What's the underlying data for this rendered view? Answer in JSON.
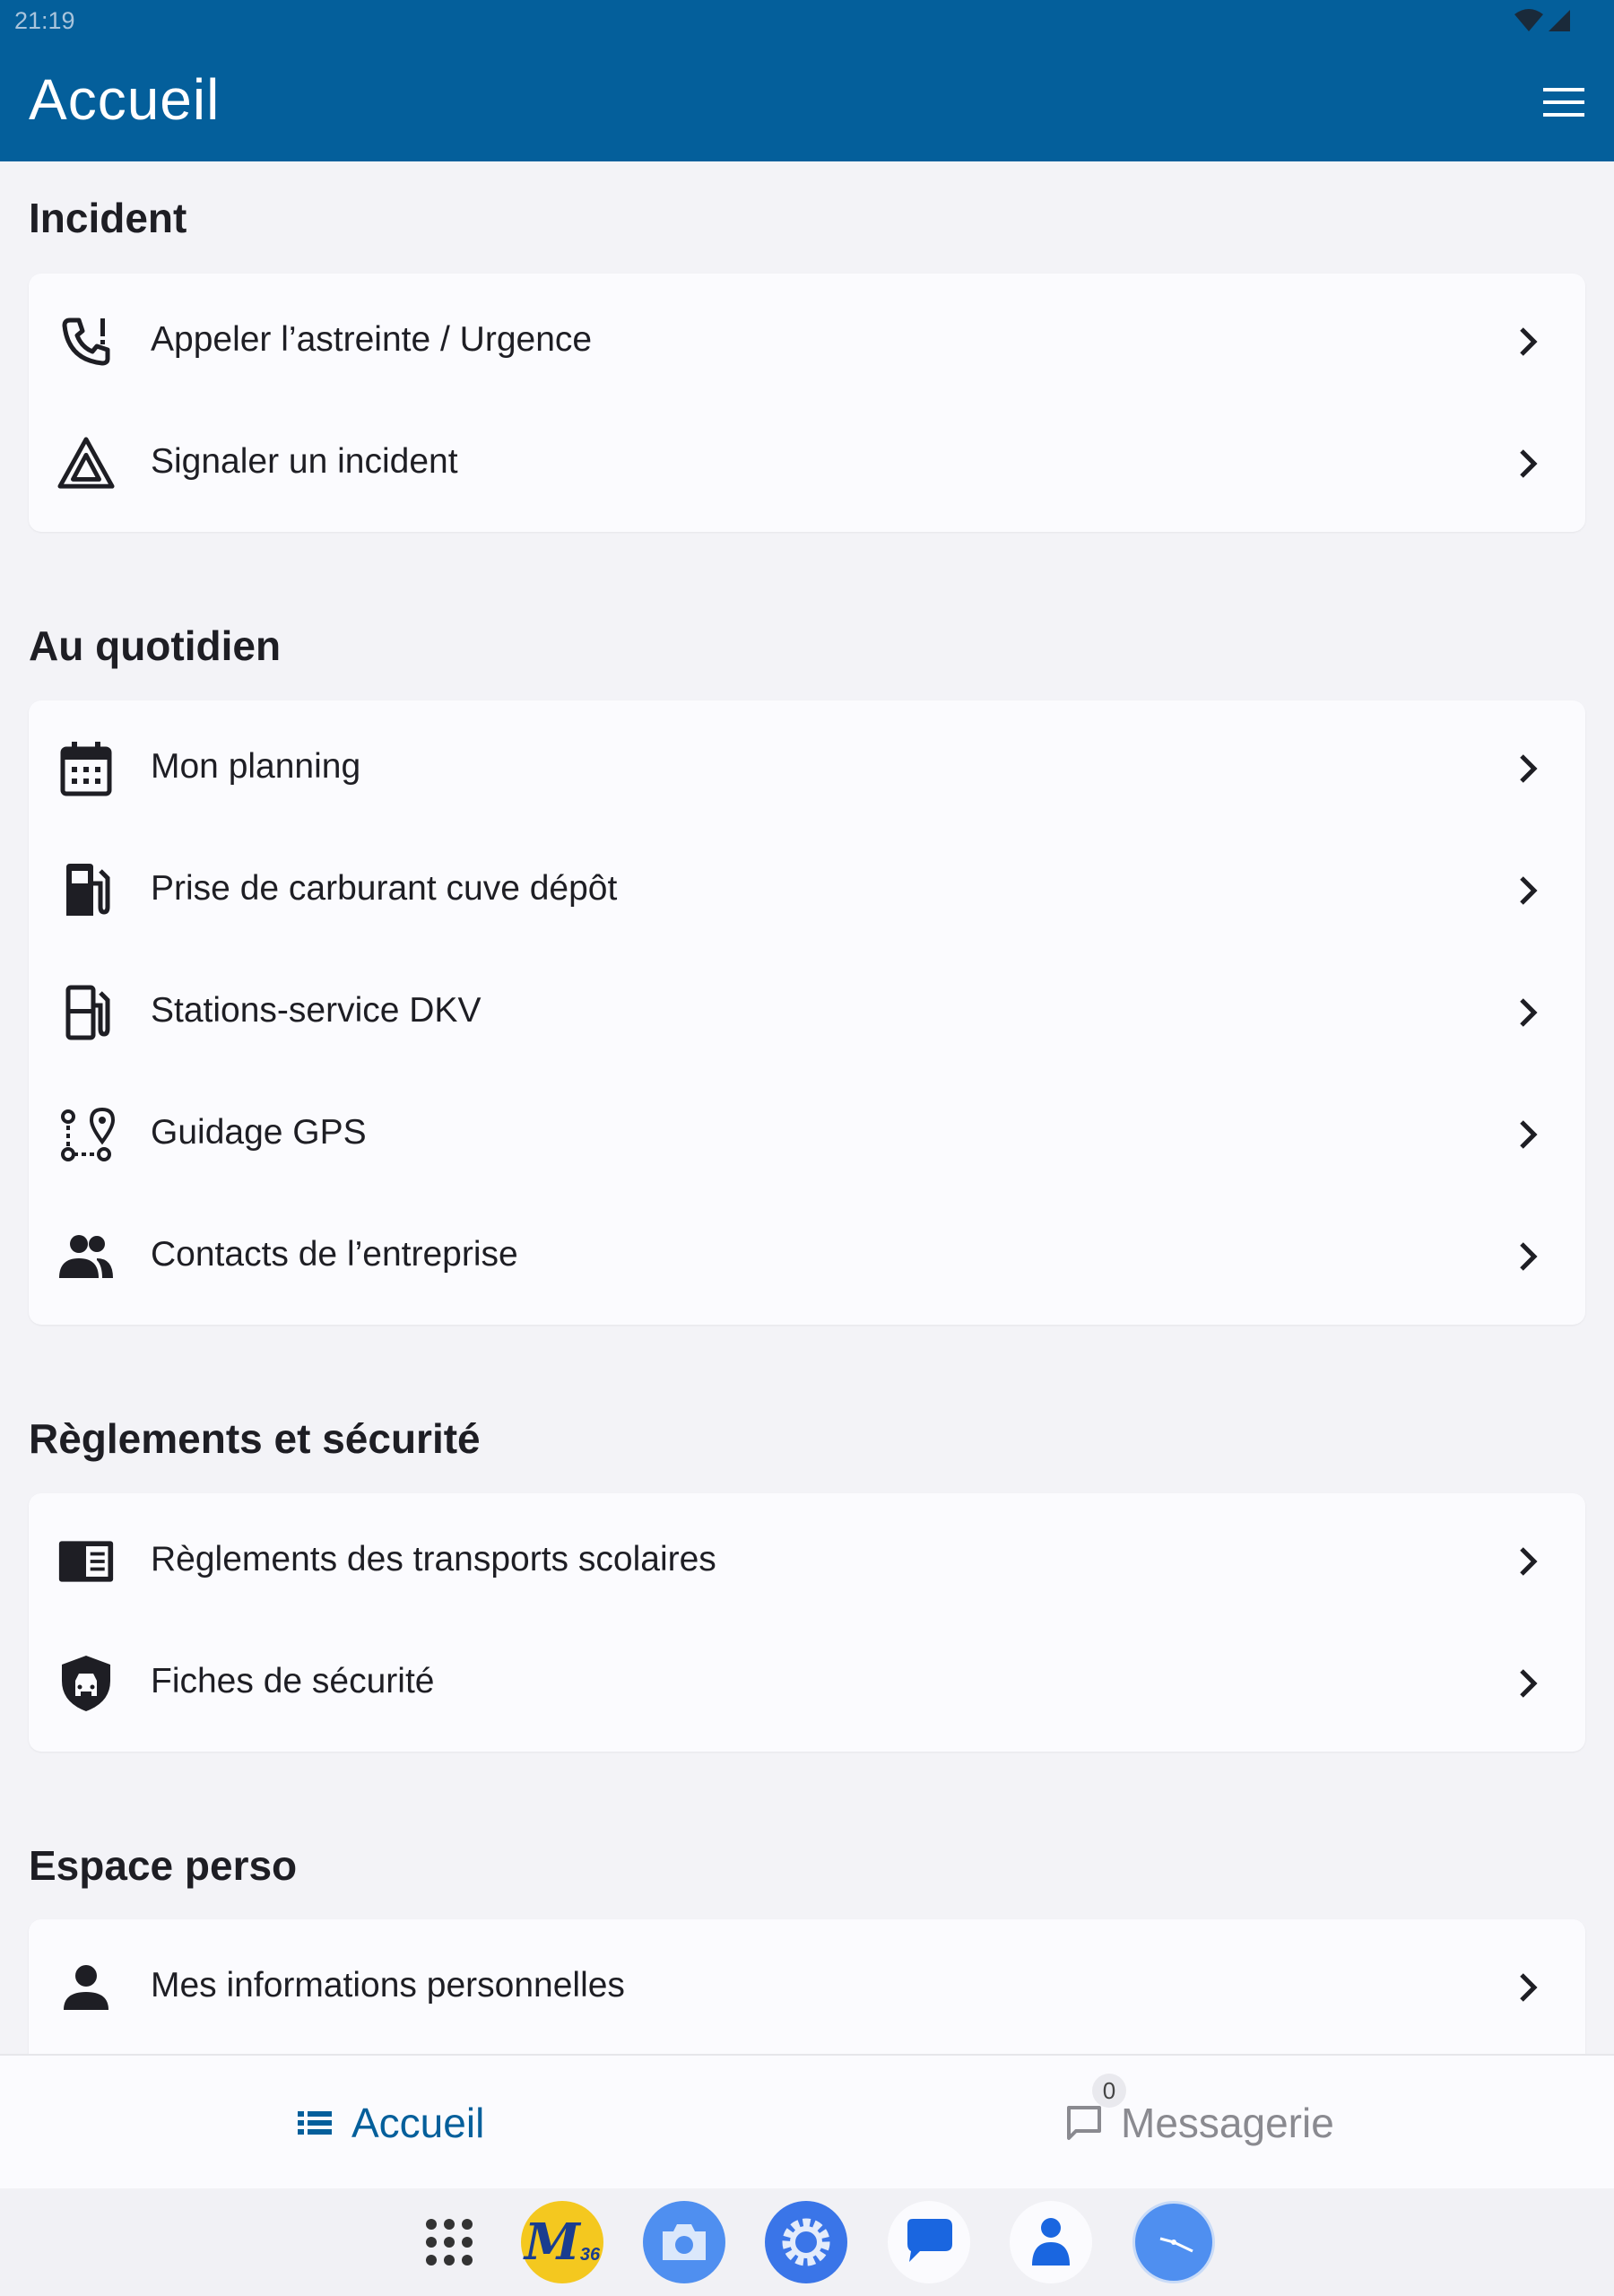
{
  "status_bar": {
    "time": "21:19"
  },
  "app_bar": {
    "title": "Accueil"
  },
  "sections": [
    {
      "title": "Incident",
      "items": [
        {
          "label": "Appeler l’astreinte / Urgence",
          "icon": "phone-alert-icon"
        },
        {
          "label": "Signaler un incident",
          "icon": "warning-triangle-icon"
        }
      ]
    },
    {
      "title": "Au quotidien",
      "items": [
        {
          "label": "Mon planning",
          "icon": "calendar-icon"
        },
        {
          "label": "Prise de carburant cuve dépôt",
          "icon": "fuel-filled-icon"
        },
        {
          "label": "Stations-service DKV",
          "icon": "fuel-station-outline-icon"
        },
        {
          "label": "Guidage GPS",
          "icon": "route-pin-icon"
        },
        {
          "label": "Contacts de l’entreprise",
          "icon": "people-icon"
        }
      ]
    },
    {
      "title": "Règlements et sécurité",
      "items": [
        {
          "label": "Règlements des transports scolaires",
          "icon": "book-icon"
        },
        {
          "label": "Fiches de sécurité",
          "icon": "shield-car-icon"
        }
      ]
    },
    {
      "title": "Espace perso",
      "items": [
        {
          "label": "Mes informations personnelles",
          "icon": "person-icon"
        }
      ]
    }
  ],
  "bottom_nav": {
    "home_label": "Accueil",
    "messages_label": "Messagerie",
    "messages_badge": "0"
  },
  "dock": {
    "logo_text": "M",
    "logo_sub": "36",
    "apps": [
      "apps-grid-icon",
      "m36-logo",
      "camera-icon",
      "settings-icon",
      "messages-app-icon",
      "contacts-icon",
      "clock-icon"
    ]
  },
  "colors": {
    "app_bar": "#045f9b",
    "accent": "#045f9b",
    "background": "#f3f3f7",
    "card": "#fbfbfe"
  }
}
